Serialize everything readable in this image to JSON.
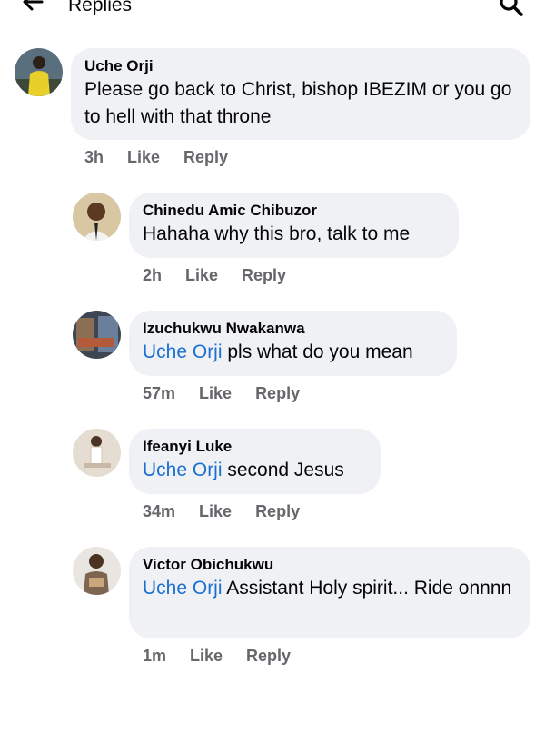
{
  "header": {
    "title": "Replies"
  },
  "icons": {
    "back": "arrow-left-icon",
    "search": "search-icon"
  },
  "comments": [
    {
      "name": "Uche Orji",
      "text": "Please go back to Christ,  bishop IBEZIM or you go to hell with that throne",
      "time": "3h",
      "like": "Like",
      "reply": "Reply"
    },
    {
      "name": "Chinedu Amic Chibuzor",
      "text": "Hahaha why this bro, talk to me",
      "time": "2h",
      "like": "Like",
      "reply": "Reply"
    },
    {
      "name": "Izuchukwu Nwakanwa",
      "mention": "Uche Orji",
      "text": " pls what do you mean",
      "time": "57m",
      "like": "Like",
      "reply": "Reply"
    },
    {
      "name": "Ifeanyi Luke",
      "mention": "Uche Orji",
      "text": " second Jesus",
      "time": "34m",
      "like": "Like",
      "reply": "Reply"
    },
    {
      "name": "Victor Obichukwu",
      "mention": "Uche Orji",
      "text": " Assistant Holy spirit... Ride onnnn",
      "time": "1m",
      "like": "Like",
      "reply": "Reply"
    }
  ],
  "colors": {
    "bubble": "#eff1f4",
    "mention": "#1a6fd1",
    "meta": "#65676b",
    "divider": "#cfd2d6"
  }
}
